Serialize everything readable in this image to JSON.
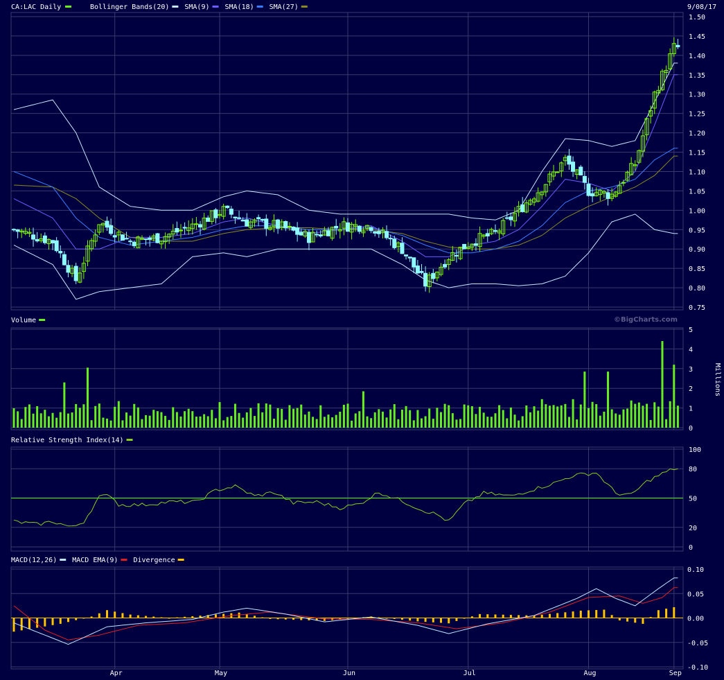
{
  "header": {
    "symbol_label": "CA:LAC Daily",
    "date": "9/08/17"
  },
  "watermark": "©BigCharts.com",
  "colors": {
    "background": "#000040",
    "grid": "#3a3a70",
    "candle_up": "#7cfc00",
    "candle_down": "#8ff8ff",
    "bollinger": "#c8e8ff",
    "sma9": "#6a5cff",
    "sma18": "#3a7cff",
    "sma27": "#8a8a20",
    "volume": "#66ee22",
    "rsi": "#88cc22",
    "rsi_ref": "#44ff22",
    "macd": "#bfe6ff",
    "macd_ema": "#e02020",
    "divergence": "#ffc400"
  },
  "x_axis": {
    "labels": [
      "Apr",
      "May",
      "Jun",
      "Jul",
      "Aug",
      "Sep"
    ]
  },
  "chart_data": [
    {
      "type": "candlestick",
      "panel": "price",
      "legend": [
        {
          "label": "Bollinger Bands(20)",
          "color": "#c8e8ff"
        },
        {
          "label": "SMA(9)",
          "color": "#6a5cff"
        },
        {
          "label": "SMA(18)",
          "color": "#3a7cff"
        },
        {
          "label": "SMA(27)",
          "color": "#8a8a20"
        }
      ],
      "ylim": [
        0.75,
        1.5
      ],
      "y_ticks": [
        "1.50",
        "1.45",
        "1.40",
        "1.35",
        "1.30",
        "1.25",
        "1.20",
        "1.15",
        "1.10",
        "1.05",
        "1.00",
        "0.95",
        "0.90",
        "0.85",
        "0.80",
        "0.75"
      ],
      "keypoints": [
        {
          "x": 0,
          "close": 0.95,
          "boll_up": 1.26,
          "boll_low": 0.91,
          "sma9": 1.03,
          "sma18": 1.1,
          "sma27": 1.065
        },
        {
          "x": 10,
          "close": 0.92,
          "boll_up": 1.285,
          "boll_low": 0.86,
          "sma9": 0.98,
          "sma18": 1.06,
          "sma27": 1.06
        },
        {
          "x": 16,
          "close": 0.82,
          "boll_up": 1.2,
          "boll_low": 0.77,
          "sma9": 0.9,
          "sma18": 0.98,
          "sma27": 1.03
        },
        {
          "x": 22,
          "close": 0.97,
          "boll_up": 1.06,
          "boll_low": 0.79,
          "sma9": 0.9,
          "sma18": 0.93,
          "sma27": 0.98
        },
        {
          "x": 30,
          "close": 0.92,
          "boll_up": 1.01,
          "boll_low": 0.8,
          "sma9": 0.93,
          "sma18": 0.91,
          "sma27": 0.93
        },
        {
          "x": 38,
          "close": 0.93,
          "boll_up": 1.0,
          "boll_low": 0.81,
          "sma9": 0.93,
          "sma18": 0.92,
          "sma27": 0.92
        },
        {
          "x": 46,
          "close": 0.96,
          "boll_up": 1.0,
          "boll_low": 0.88,
          "sma9": 0.94,
          "sma18": 0.93,
          "sma27": 0.92
        },
        {
          "x": 54,
          "close": 1.0,
          "boll_up": 1.035,
          "boll_low": 0.89,
          "sma9": 0.97,
          "sma18": 0.95,
          "sma27": 0.94
        },
        {
          "x": 60,
          "close": 0.97,
          "boll_up": 1.05,
          "boll_low": 0.88,
          "sma9": 0.98,
          "sma18": 0.96,
          "sma27": 0.95
        },
        {
          "x": 68,
          "close": 0.96,
          "boll_up": 1.04,
          "boll_low": 0.9,
          "sma9": 0.96,
          "sma18": 0.96,
          "sma27": 0.955
        },
        {
          "x": 76,
          "close": 0.93,
          "boll_up": 1.0,
          "boll_low": 0.9,
          "sma9": 0.94,
          "sma18": 0.95,
          "sma27": 0.955
        },
        {
          "x": 84,
          "close": 0.96,
          "boll_up": 0.99,
          "boll_low": 0.9,
          "sma9": 0.95,
          "sma18": 0.95,
          "sma27": 0.95
        },
        {
          "x": 92,
          "close": 0.96,
          "boll_up": 0.99,
          "boll_low": 0.9,
          "sma9": 0.96,
          "sma18": 0.955,
          "sma27": 0.95
        },
        {
          "x": 100,
          "close": 0.9,
          "boll_up": 0.99,
          "boll_low": 0.86,
          "sma9": 0.92,
          "sma18": 0.935,
          "sma27": 0.94
        },
        {
          "x": 106,
          "close": 0.81,
          "boll_up": 0.99,
          "boll_low": 0.82,
          "sma9": 0.88,
          "sma18": 0.91,
          "sma27": 0.92
        },
        {
          "x": 112,
          "close": 0.88,
          "boll_up": 0.99,
          "boll_low": 0.8,
          "sma9": 0.88,
          "sma18": 0.89,
          "sma27": 0.905
        },
        {
          "x": 118,
          "close": 0.92,
          "boll_up": 0.98,
          "boll_low": 0.81,
          "sma9": 0.91,
          "sma18": 0.89,
          "sma27": 0.9
        },
        {
          "x": 124,
          "close": 0.94,
          "boll_up": 0.975,
          "boll_low": 0.81,
          "sma9": 0.92,
          "sma18": 0.9,
          "sma27": 0.9
        },
        {
          "x": 130,
          "close": 1.0,
          "boll_up": 1.0,
          "boll_low": 0.805,
          "sma9": 0.95,
          "sma18": 0.92,
          "sma27": 0.91
        },
        {
          "x": 136,
          "close": 1.06,
          "boll_up": 1.1,
          "boll_low": 0.81,
          "sma9": 1.01,
          "sma18": 0.96,
          "sma27": 0.935
        },
        {
          "x": 142,
          "close": 1.13,
          "boll_up": 1.185,
          "boll_low": 0.83,
          "sma9": 1.08,
          "sma18": 1.02,
          "sma27": 0.98
        },
        {
          "x": 148,
          "close": 1.05,
          "boll_up": 1.18,
          "boll_low": 0.89,
          "sma9": 1.07,
          "sma18": 1.05,
          "sma27": 1.01
        },
        {
          "x": 154,
          "close": 1.04,
          "boll_up": 1.165,
          "boll_low": 0.97,
          "sma9": 1.05,
          "sma18": 1.06,
          "sma27": 1.035
        },
        {
          "x": 160,
          "close": 1.12,
          "boll_up": 1.18,
          "boll_low": 0.99,
          "sma9": 1.1,
          "sma18": 1.08,
          "sma27": 1.06
        },
        {
          "x": 165,
          "close": 1.3,
          "boll_up": 1.28,
          "boll_low": 0.95,
          "sma9": 1.22,
          "sma18": 1.13,
          "sma27": 1.09
        },
        {
          "x": 170,
          "close": 1.42,
          "boll_up": 1.38,
          "boll_low": 0.94,
          "sma9": 1.35,
          "sma18": 1.16,
          "sma27": 1.14
        }
      ]
    },
    {
      "type": "bar",
      "panel": "volume",
      "legend": [
        {
          "label": "Volume",
          "color": "#66ee22"
        }
      ],
      "ylabel": "Millions",
      "ylim": [
        0,
        5
      ],
      "y_ticks": [
        "5",
        "4",
        "3",
        "2",
        "1",
        "0"
      ],
      "spikes": [
        {
          "x": 13,
          "value": 2.3
        },
        {
          "x": 19,
          "value": 3.05
        },
        {
          "x": 27,
          "value": 1.35
        },
        {
          "x": 53,
          "value": 1.3
        },
        {
          "x": 90,
          "value": 1.85
        },
        {
          "x": 136,
          "value": 1.45
        },
        {
          "x": 147,
          "value": 2.85
        },
        {
          "x": 153,
          "value": 2.85
        },
        {
          "x": 167,
          "value": 4.4
        },
        {
          "x": 170,
          "value": 3.2
        }
      ]
    },
    {
      "type": "line",
      "panel": "rsi",
      "legend": [
        {
          "label": "Relative Strength Index(14)",
          "color": "#88cc22"
        }
      ],
      "ylim": [
        0,
        100
      ],
      "y_ticks": [
        "100",
        "80",
        "50",
        "20",
        "0"
      ],
      "reference": 50,
      "keypoints": [
        {
          "x": 0,
          "value": 26
        },
        {
          "x": 6,
          "value": 23
        },
        {
          "x": 10,
          "value": 26
        },
        {
          "x": 15,
          "value": 20
        },
        {
          "x": 18,
          "value": 26
        },
        {
          "x": 22,
          "value": 51
        },
        {
          "x": 25,
          "value": 53
        },
        {
          "x": 27,
          "value": 43
        },
        {
          "x": 33,
          "value": 43
        },
        {
          "x": 40,
          "value": 46
        },
        {
          "x": 47,
          "value": 46
        },
        {
          "x": 52,
          "value": 58
        },
        {
          "x": 57,
          "value": 62
        },
        {
          "x": 62,
          "value": 52
        },
        {
          "x": 67,
          "value": 56
        },
        {
          "x": 72,
          "value": 45
        },
        {
          "x": 78,
          "value": 46
        },
        {
          "x": 84,
          "value": 40
        },
        {
          "x": 89,
          "value": 44
        },
        {
          "x": 94,
          "value": 56
        },
        {
          "x": 100,
          "value": 47
        },
        {
          "x": 105,
          "value": 38
        },
        {
          "x": 109,
          "value": 33
        },
        {
          "x": 112,
          "value": 26
        },
        {
          "x": 116,
          "value": 44
        },
        {
          "x": 121,
          "value": 55
        },
        {
          "x": 128,
          "value": 52
        },
        {
          "x": 133,
          "value": 58
        },
        {
          "x": 139,
          "value": 65
        },
        {
          "x": 144,
          "value": 73
        },
        {
          "x": 150,
          "value": 76
        },
        {
          "x": 155,
          "value": 55
        },
        {
          "x": 159,
          "value": 53
        },
        {
          "x": 163,
          "value": 67
        },
        {
          "x": 167,
          "value": 75
        },
        {
          "x": 170,
          "value": 80
        }
      ]
    },
    {
      "type": "line",
      "panel": "macd",
      "legend": [
        {
          "label": "MACD(12,26)",
          "color": "#bfe6ff"
        },
        {
          "label": "MACD EMA(9)",
          "color": "#e02020"
        },
        {
          "label": "Divergence",
          "color": "#ffc400"
        }
      ],
      "ylim": [
        -0.1,
        0.1
      ],
      "y_ticks": [
        "0.10",
        "0.05",
        "0.00",
        "-0.05",
        "-0.10"
      ],
      "macd": [
        {
          "x": 0,
          "value": -0.01
        },
        {
          "x": 8,
          "value": -0.035
        },
        {
          "x": 14,
          "value": -0.054
        },
        {
          "x": 18,
          "value": -0.04
        },
        {
          "x": 24,
          "value": -0.018
        },
        {
          "x": 34,
          "value": -0.01
        },
        {
          "x": 46,
          "value": -0.003
        },
        {
          "x": 54,
          "value": 0.012
        },
        {
          "x": 60,
          "value": 0.02
        },
        {
          "x": 70,
          "value": 0.008
        },
        {
          "x": 80,
          "value": -0.008
        },
        {
          "x": 92,
          "value": 0.002
        },
        {
          "x": 104,
          "value": -0.015
        },
        {
          "x": 112,
          "value": -0.032
        },
        {
          "x": 122,
          "value": -0.012
        },
        {
          "x": 134,
          "value": 0.005
        },
        {
          "x": 145,
          "value": 0.04
        },
        {
          "x": 150,
          "value": 0.06
        },
        {
          "x": 155,
          "value": 0.04
        },
        {
          "x": 160,
          "value": 0.025
        },
        {
          "x": 166,
          "value": 0.06
        },
        {
          "x": 170,
          "value": 0.082
        }
      ],
      "ema": [
        {
          "x": 0,
          "value": 0.025
        },
        {
          "x": 8,
          "value": -0.025
        },
        {
          "x": 14,
          "value": -0.045
        },
        {
          "x": 22,
          "value": -0.035
        },
        {
          "x": 32,
          "value": -0.015
        },
        {
          "x": 44,
          "value": -0.01
        },
        {
          "x": 56,
          "value": 0.005
        },
        {
          "x": 66,
          "value": 0.012
        },
        {
          "x": 80,
          "value": -0.002
        },
        {
          "x": 92,
          "value": -0.003
        },
        {
          "x": 104,
          "value": -0.01
        },
        {
          "x": 114,
          "value": -0.022
        },
        {
          "x": 126,
          "value": -0.01
        },
        {
          "x": 138,
          "value": 0.012
        },
        {
          "x": 148,
          "value": 0.042
        },
        {
          "x": 156,
          "value": 0.045
        },
        {
          "x": 162,
          "value": 0.03
        },
        {
          "x": 167,
          "value": 0.042
        },
        {
          "x": 170,
          "value": 0.062
        }
      ],
      "divergence": [
        {
          "x": 0,
          "value": -0.028
        },
        {
          "x": 6,
          "value": -0.02
        },
        {
          "x": 12,
          "value": -0.012
        },
        {
          "x": 20,
          "value": 0.003
        },
        {
          "x": 24,
          "value": 0.016
        },
        {
          "x": 30,
          "value": 0.007
        },
        {
          "x": 40,
          "value": 0.0
        },
        {
          "x": 50,
          "value": 0.006
        },
        {
          "x": 58,
          "value": 0.011
        },
        {
          "x": 66,
          "value": -0.002
        },
        {
          "x": 80,
          "value": -0.006
        },
        {
          "x": 92,
          "value": 0.003
        },
        {
          "x": 104,
          "value": -0.007
        },
        {
          "x": 112,
          "value": -0.011
        },
        {
          "x": 120,
          "value": 0.008
        },
        {
          "x": 134,
          "value": 0.005
        },
        {
          "x": 146,
          "value": 0.015
        },
        {
          "x": 152,
          "value": 0.017
        },
        {
          "x": 156,
          "value": -0.005
        },
        {
          "x": 162,
          "value": -0.012
        },
        {
          "x": 166,
          "value": 0.016
        },
        {
          "x": 170,
          "value": 0.022
        }
      ]
    }
  ]
}
